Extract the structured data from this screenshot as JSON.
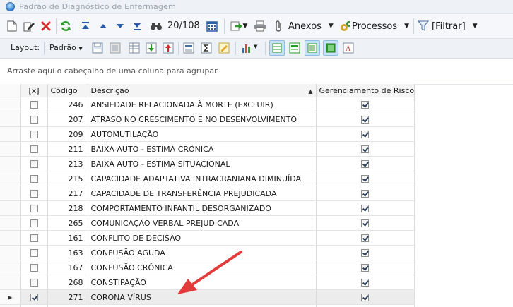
{
  "window": {
    "title": "Padrão de Diagnóstico de Enfermagem"
  },
  "toolbar": {
    "record_counter": "20/108",
    "anexos_label": "Anexos",
    "processos_label": "Processos",
    "filtrar_label": "[Filtrar]"
  },
  "layout_bar": {
    "layout_label": "Layout:",
    "padrao_label": "Padrão"
  },
  "group_area": {
    "hint": "Arraste aqui o cabeçalho de uma coluna para agrupar"
  },
  "grid": {
    "columns": {
      "select": "[x]",
      "code": "Código",
      "description": "Descrição",
      "risk": "Gerenciamento de Risco"
    },
    "rows": [
      {
        "code": "246",
        "description": "ANSIEDADE RELACIONADA À MORTE (EXCLUIR)",
        "selected": false,
        "risk": true
      },
      {
        "code": "207",
        "description": "ATRASO NO CRESCIMENTO E NO DESENVOLVIMENTO",
        "selected": false,
        "risk": true
      },
      {
        "code": "209",
        "description": "AUTOMUTILAÇÃO",
        "selected": false,
        "risk": true
      },
      {
        "code": "211",
        "description": "BAIXA AUTO - ESTIMA CRÔNICA",
        "selected": false,
        "risk": true
      },
      {
        "code": "213",
        "description": "BAIXA AUTO - ESTIMA SITUACIONAL",
        "selected": false,
        "risk": true
      },
      {
        "code": "215",
        "description": "CAPACIDADE ADAPTATIVA INTRACRANIANA DIMINUÍDA",
        "selected": false,
        "risk": true
      },
      {
        "code": "217",
        "description": "CAPACIDADE DE TRANSFERÊNCIA PREJUDICADA",
        "selected": false,
        "risk": true
      },
      {
        "code": "218",
        "description": "COMPORTAMENTO INFANTIL DESORGANIZADO",
        "selected": false,
        "risk": true
      },
      {
        "code": "265",
        "description": "COMUNICAÇÃO VERBAL PREJUDICADA",
        "selected": false,
        "risk": true
      },
      {
        "code": "161",
        "description": "CONFLITO DE DECISÃO",
        "selected": false,
        "risk": true
      },
      {
        "code": "163",
        "description": "CONFUSÃO AGUDA",
        "selected": false,
        "risk": true
      },
      {
        "code": "167",
        "description": "CONFUSÃO CRÔNICA",
        "selected": false,
        "risk": true
      },
      {
        "code": "268",
        "description": "CONSTIPAÇÃO",
        "selected": false,
        "risk": true
      },
      {
        "code": "271",
        "description": "CORONA VÍRUS",
        "selected": true,
        "risk": true,
        "current": true
      },
      {
        "code": "",
        "description": "",
        "selected": false,
        "risk": true
      }
    ]
  },
  "colors": {
    "arrow": "#e23b3b",
    "selected_button": "#c7e1f7"
  }
}
